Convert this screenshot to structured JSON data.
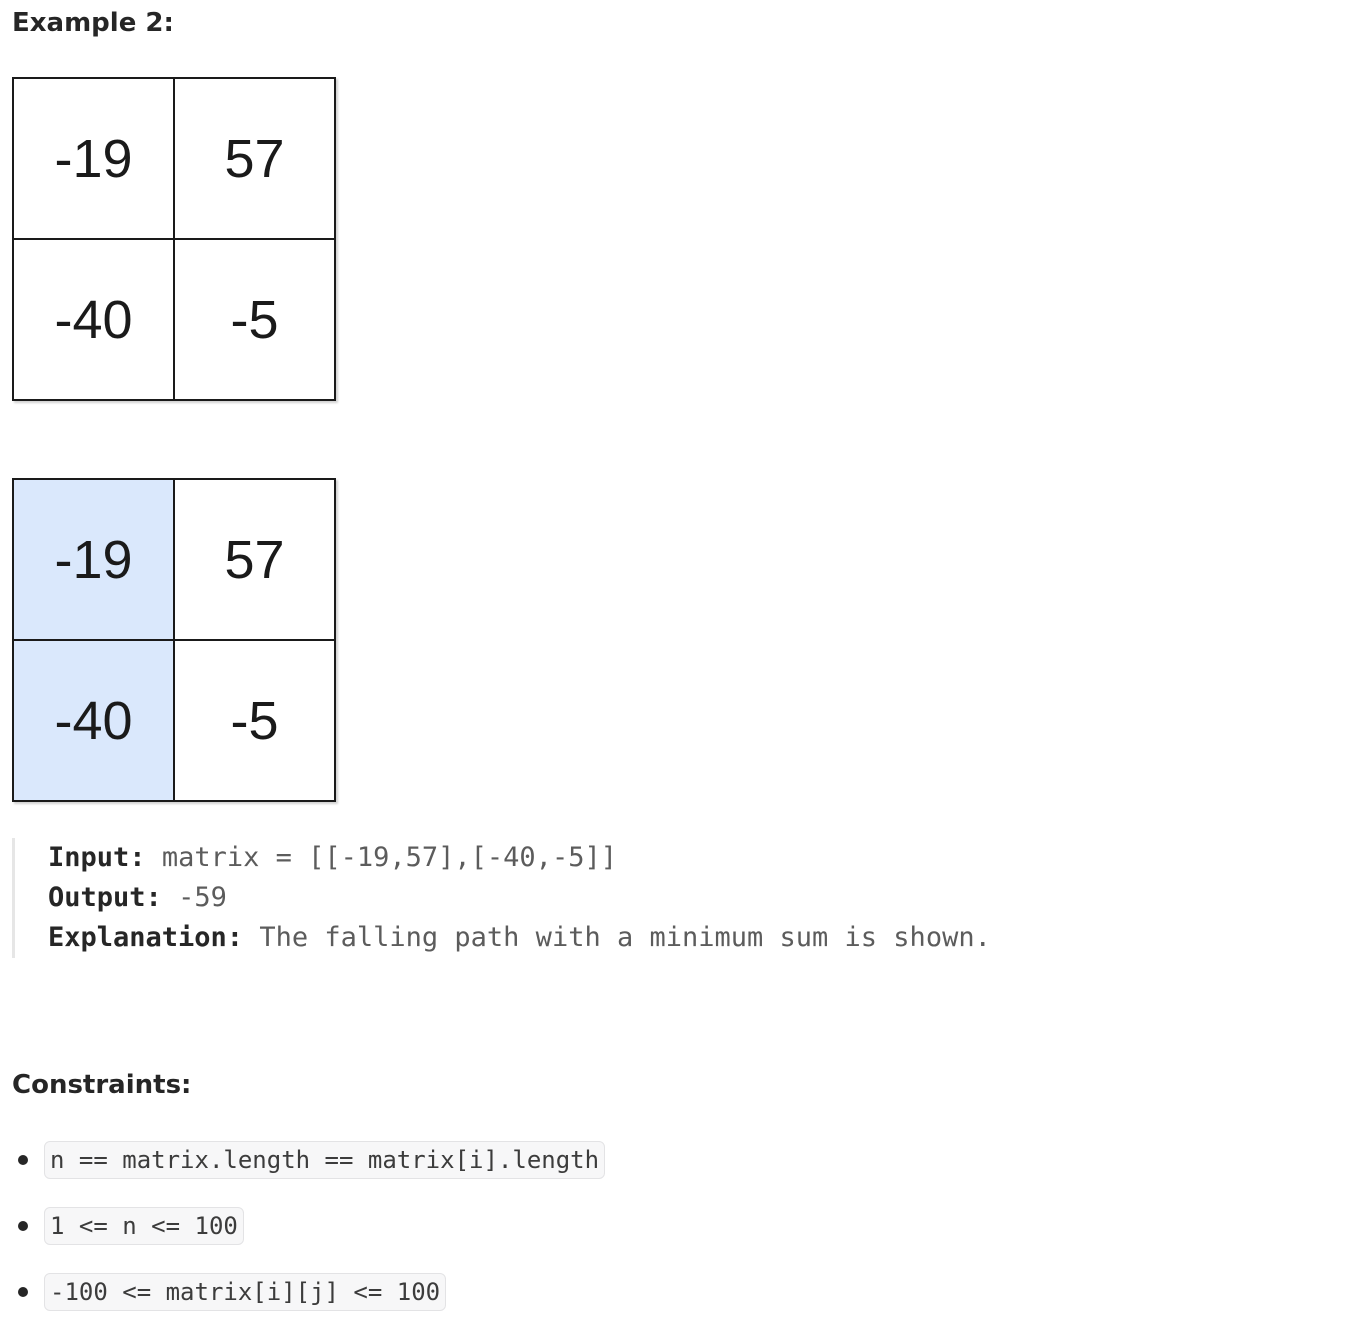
{
  "example": {
    "title": "Example 2:",
    "grid_input": [
      [
        "-19",
        "57"
      ],
      [
        "-40",
        "-5"
      ]
    ],
    "grid_path": [
      [
        "-19",
        "57"
      ],
      [
        "-40",
        "-5"
      ]
    ],
    "path_highlight": [
      [
        true,
        false
      ],
      [
        true,
        false
      ]
    ],
    "highlight_color": "#dae8fc",
    "input_label": "Input:",
    "input_value": "matrix = [[-19,57],[-40,-5]]",
    "output_label": "Output:",
    "output_value": "-59",
    "explanation_label": "Explanation:",
    "explanation_value": "The falling path with a minimum sum is shown."
  },
  "constraints": {
    "title": "Constraints:",
    "items": [
      "n == matrix.length == matrix[i].length",
      "1 <= n <= 100",
      "-100 <= matrix[i][j] <= 100"
    ]
  }
}
